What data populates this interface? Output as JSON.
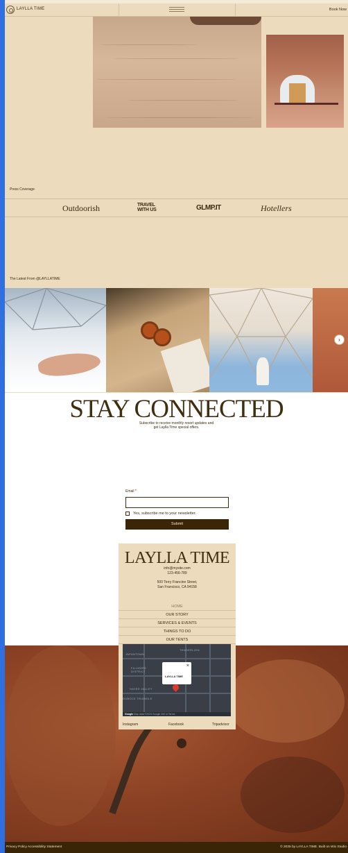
{
  "header": {
    "brand": "LAYLLA TIME",
    "book_label": "Book Now"
  },
  "press": {
    "label": "Press Coverage",
    "logos": [
      "Outdoorish",
      "TRAVEL WITH US",
      "GLMP.IT",
      "Hotellers"
    ]
  },
  "latest": {
    "label": "The Latest From @LAYLLATIME"
  },
  "newsletter": {
    "title": "STAY CONNECTED",
    "subtitle_line1": "Subscribe to receive monthly resort updates and",
    "subtitle_line2": "get Laylla Time special offers.",
    "email_label": "Email",
    "required_mark": "*",
    "email_value": "",
    "checkbox_label": "Yes, subscribe me to your newsletter.",
    "submit_label": "Submit"
  },
  "footer_card": {
    "logo": "LAYLLA TIME",
    "email": "info@mysite.com",
    "phone": "123-456-789",
    "address_line1": "500 Terry Francine Street,",
    "address_line2": "San Francisco, CA 94158",
    "nav": [
      "HOME",
      "OUR STORY",
      "SERVICES & EVENTS",
      "THINGS TO DO",
      "OUR TENTS"
    ],
    "map": {
      "areas": [
        "JAPANTOWN",
        "TENDERLOIN",
        "FILLMORE DISTRICT",
        "HAYES VALLEY",
        "DUBOCE TRIANGLE"
      ],
      "popup_title": "LAYLLA TIME",
      "google": "Google",
      "attribution": "Map data ©2024 Google   200 m        Terms"
    },
    "social": [
      "Instagram",
      "Facebook",
      "Tripadvisor"
    ]
  },
  "bottom_bar": {
    "links": "Privacy Policy   Accessibility Statement",
    "copyright": "© 2035 by LAYLLA TIME. Built on Wix Studio"
  },
  "colors": {
    "beige": "#ecdcbd",
    "dark_brown": "#3a2606",
    "text": "#3a2a10",
    "accent_blue": "#2f6fe0"
  }
}
